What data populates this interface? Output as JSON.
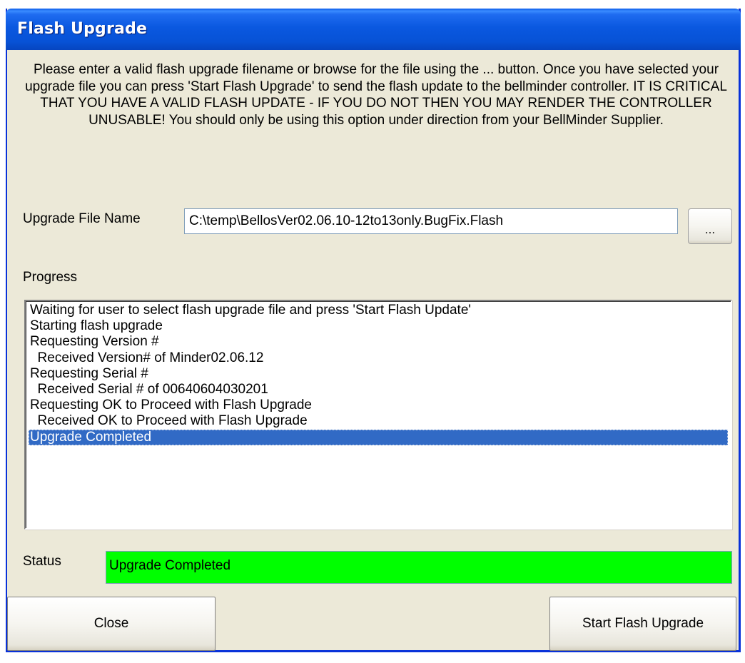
{
  "window": {
    "title": "Flash Upgrade"
  },
  "instructions": "Please enter a valid flash upgrade filename or browse for the file using the ... button.  Once you have selected your upgrade file you can press 'Start Flash Upgrade' to send the flash update to the bellminder controller. IT IS CRITICAL THAT YOU HAVE A VALID FLASH UPDATE - IF YOU DO NOT THEN YOU MAY RENDER THE CONTROLLER UNUSABLE!  You should only be using this option under direction from your BellMinder Supplier.",
  "file": {
    "label": "Upgrade File Name",
    "value": "C:\\temp\\BellosVer02.06.10-12to13only.BugFix.Flash",
    "browse_label": "..."
  },
  "progress": {
    "label": "Progress",
    "items": [
      "Waiting for user to select flash upgrade file and press 'Start Flash Update'",
      "Starting flash upgrade",
      "Requesting Version #",
      "  Received Version# of Minder02.06.12",
      "Requesting Serial #",
      "  Received Serial # of 00640604030201",
      "Requesting OK to Proceed with Flash Upgrade",
      "  Received OK to Proceed with Flash Upgrade",
      "Upgrade Completed"
    ],
    "selected_index": 8
  },
  "status": {
    "label": "Status",
    "value": "Upgrade Completed",
    "color": "#00ff00"
  },
  "buttons": {
    "close_label": "Close",
    "start_label": "Start Flash Upgrade"
  },
  "colors": {
    "title_bar": "#0a58e0",
    "dialog_bg": "#ece9d8",
    "selection": "#316ac5"
  }
}
